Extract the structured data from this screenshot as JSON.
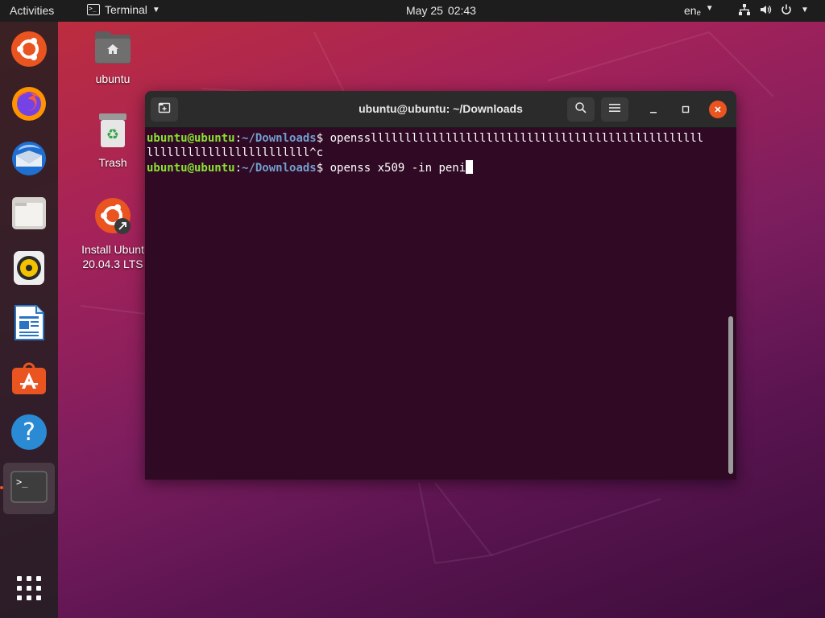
{
  "topbar": {
    "activities": "Activities",
    "app_name": "Terminal",
    "app_icon_glyph": ">_",
    "date": "May 25",
    "time": "02:43",
    "language": "enₑ",
    "tray_icons": [
      "network-icon",
      "volume-icon",
      "power-icon"
    ]
  },
  "dock": {
    "items": [
      {
        "name": "ubuntu-installer",
        "icon": "ubuntu-logo-icon"
      },
      {
        "name": "firefox",
        "icon": "firefox-icon"
      },
      {
        "name": "thunderbird",
        "icon": "thunderbird-icon"
      },
      {
        "name": "files",
        "icon": "folder-icon"
      },
      {
        "name": "rhythmbox",
        "icon": "speaker-icon"
      },
      {
        "name": "libreoffice-writer",
        "icon": "document-icon"
      },
      {
        "name": "ubuntu-software",
        "icon": "shopping-bag-icon"
      },
      {
        "name": "help",
        "icon": "help-icon"
      },
      {
        "name": "terminal",
        "icon": "terminal-icon",
        "active": true
      }
    ],
    "show_apps_icon": "grid-icon"
  },
  "desktop": {
    "icons": [
      {
        "label": "ubuntu",
        "icon": "home-folder-icon"
      },
      {
        "label": "Trash",
        "icon": "trash-icon"
      },
      {
        "label": "Install Ubunt\n20.04.3 LTS",
        "icon": "install-ubuntu-icon"
      }
    ]
  },
  "terminal": {
    "title": "ubuntu@ubuntu: ~/Downloads",
    "prompt_user": "ubuntu@ubuntu",
    "prompt_colon": ":",
    "prompt_path": "~/Downloads",
    "prompt_symbol": "$ ",
    "line1_cmd": "opensslllllllllllllllllllllllllllllllllllllllllllllllll",
    "line2": "llllllllllllllllllllllll^c",
    "line3_cmd": "openss x509 -in peni",
    "colors": {
      "background": "#300a24",
      "user": "#8ae234",
      "path": "#729fcf",
      "close": "#e95420"
    }
  }
}
